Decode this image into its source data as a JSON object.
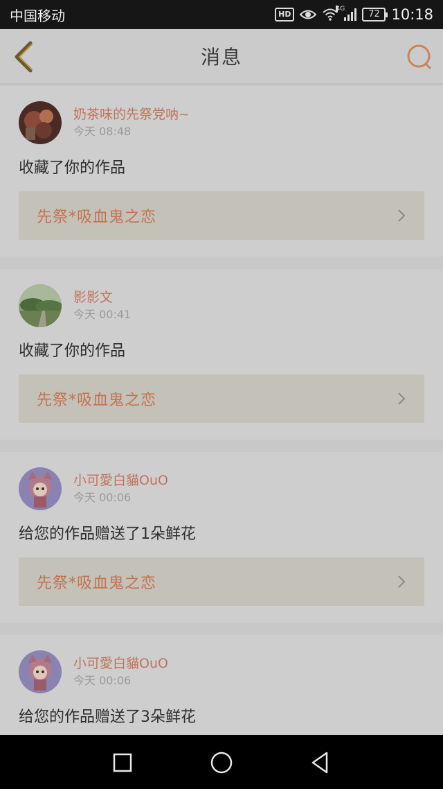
{
  "status_bar": {
    "carrier": "中国移动",
    "hd": "HD",
    "network": "4G",
    "battery": "72",
    "time": "10:18"
  },
  "header": {
    "title": "消息",
    "back_icon": "chevron-left-icon",
    "search_icon": "search-icon"
  },
  "colors": {
    "accent": "#c0745a",
    "background": "#c8c8c8"
  },
  "messages": [
    {
      "username": "奶茶味的先祭党呐~",
      "time": "今天 08:48",
      "action": "收藏了你的作品",
      "work_title": "先祭*吸血鬼之恋"
    },
    {
      "username": "影影文",
      "time": "今天 00:41",
      "action": "收藏了你的作品",
      "work_title": "先祭*吸血鬼之恋"
    },
    {
      "username": "小可愛白貓OuO",
      "time": "今天 00:06",
      "action": "给您的作品赠送了1朵鲜花",
      "work_title": "先祭*吸血鬼之恋"
    },
    {
      "username": "小可愛白貓OuO",
      "time": "今天 00:06",
      "action": "给您的作品赠送了3朵鲜花",
      "work_title": ""
    }
  ],
  "nav_bar": {
    "recents_icon": "square-icon",
    "home_icon": "circle-icon",
    "back_icon": "triangle-back-icon"
  }
}
